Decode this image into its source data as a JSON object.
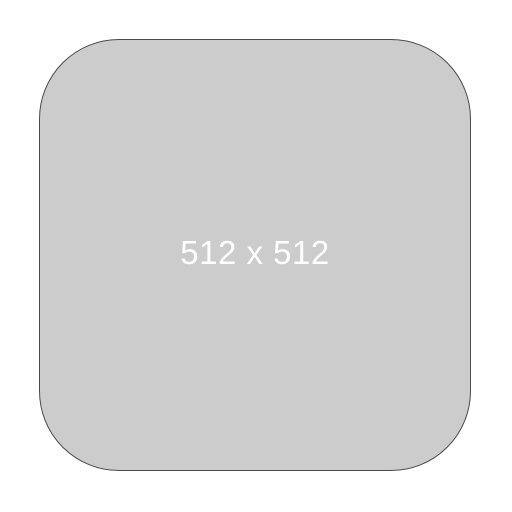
{
  "placeholder": {
    "label": "512 x 512",
    "fill_color": "#cccccc",
    "border_color": "#4a4a4a",
    "text_color": "#ffffff",
    "background_color": "#ffffff"
  }
}
